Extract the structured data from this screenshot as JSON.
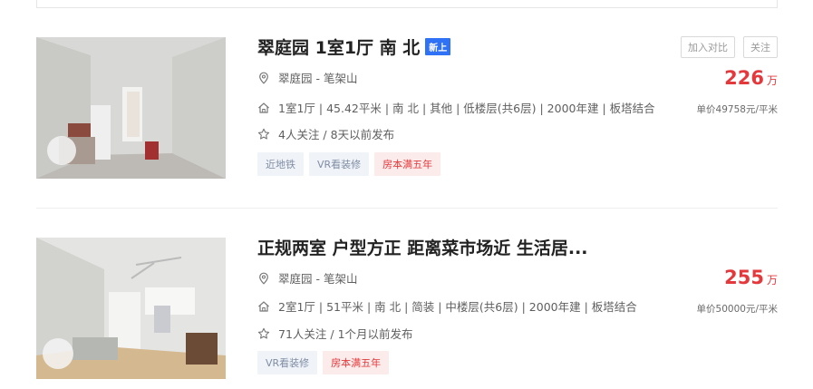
{
  "listings": [
    {
      "title": "翠庭园 1室1厅 南 北",
      "badge": "新上",
      "location": "翠庭园 - 笔架山",
      "info": "1室1厅 | 45.42平米 | 南 北 | 其他 | 低楼层(共6层) | 2000年建 | 板塔结合",
      "follow": "4人关注 / 8天以前发布",
      "tags": [
        "近地铁",
        "VR看装修",
        "房本满五年"
      ],
      "actions": [
        "加入对比",
        "关注"
      ],
      "price": "226",
      "price_unit": "万",
      "unit_price": "单价49758元/平米"
    },
    {
      "title": "正规两室 户型方正 距离菜市场近 生活居...",
      "location": "翠庭园 - 笔架山",
      "info": "2室1厅 | 51平米 | 南 北 | 简装 | 中楼层(共6层) | 2000年建 | 板塔结合",
      "follow": "71人关注 / 1个月以前发布",
      "tags": [
        "VR看装修",
        "房本满五年"
      ],
      "price": "255",
      "price_unit": "万",
      "unit_price": "单价50000元/平米"
    }
  ],
  "icons": [
    "location-pin-icon",
    "house-icon",
    "star-icon"
  ]
}
